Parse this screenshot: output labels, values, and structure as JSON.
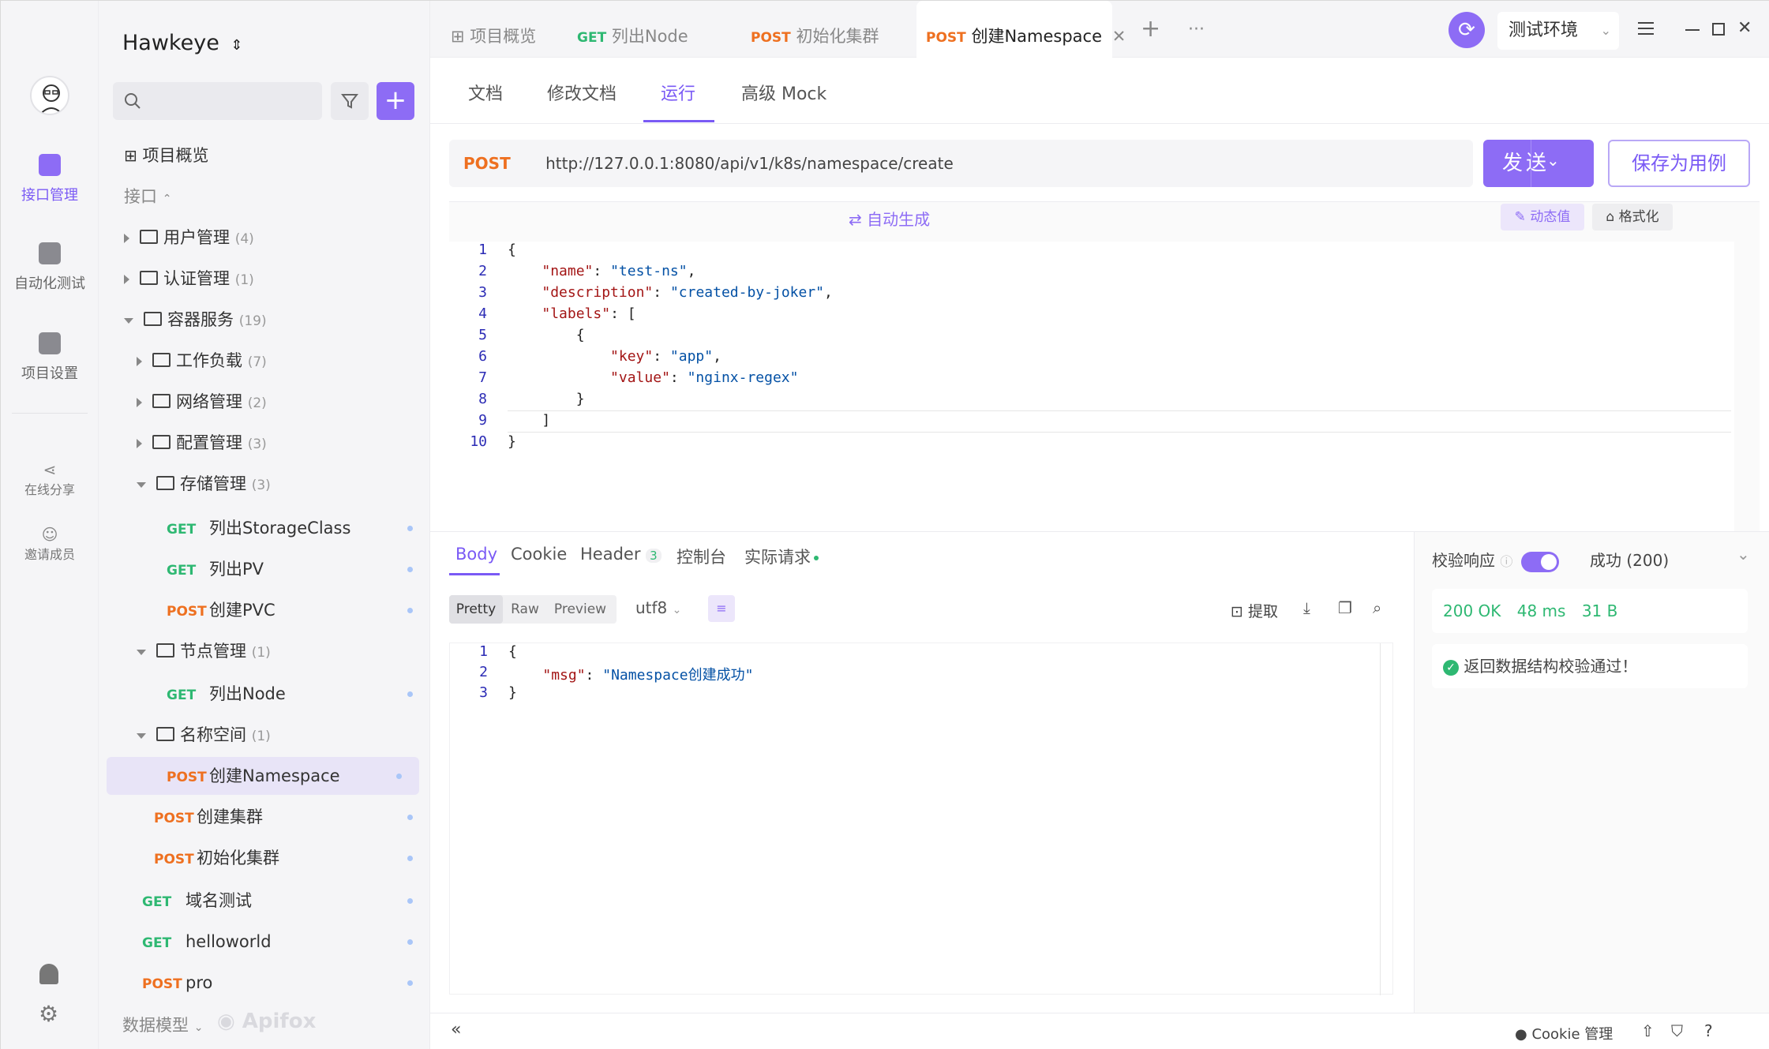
{
  "rail": {
    "items": [
      {
        "label": "接口管理"
      },
      {
        "label": "自动化测试"
      },
      {
        "label": "项目设置"
      }
    ],
    "share": "在线分享",
    "invite": "邀请成员"
  },
  "project": {
    "name": "Hawkeye",
    "switch_glyph": "⌃⌄"
  },
  "tree": {
    "overview": "项目概览",
    "api_label": "接口",
    "nodes": [
      {
        "name": "用户管理",
        "count": "(4)"
      },
      {
        "name": "认证管理",
        "count": "(1)"
      },
      {
        "name": "容器服务",
        "count": "(19)"
      },
      {
        "name": "工作负载",
        "count": "(7)"
      },
      {
        "name": "网络管理",
        "count": "(2)"
      },
      {
        "name": "配置管理",
        "count": "(3)"
      },
      {
        "name": "存储管理",
        "count": "(3)"
      },
      {
        "method": "GET",
        "name": "列出StorageClass"
      },
      {
        "method": "GET",
        "name": "列出PV"
      },
      {
        "method": "POST",
        "name": "创建PVC"
      },
      {
        "name": "节点管理",
        "count": "(1)"
      },
      {
        "method": "GET",
        "name": "列出Node"
      },
      {
        "name": "名称空间",
        "count": "(1)"
      },
      {
        "method": "POST",
        "name": "创建Namespace"
      },
      {
        "method": "POST",
        "name": "创建集群"
      },
      {
        "method": "POST",
        "name": "初始化集群"
      },
      {
        "method": "GET",
        "name": "域名测试"
      },
      {
        "method": "GET",
        "name": "helloworld"
      },
      {
        "method": "POST",
        "name": "pro"
      }
    ],
    "data_model": "数据模型",
    "brand": "Apifox"
  },
  "tabs": [
    {
      "method": "",
      "label": "项目概览"
    },
    {
      "method": "GET",
      "label": "列出Node"
    },
    {
      "method": "POST",
      "label": "初始化集群"
    },
    {
      "method": "POST",
      "label": "创建Namespace"
    }
  ],
  "tab_add": "+",
  "tab_more": "···",
  "env": {
    "label": "测试环境"
  },
  "subnav": [
    "文档",
    "修改文档",
    "运行",
    "高级 Mock"
  ],
  "request": {
    "method": "POST",
    "url": "http://127.0.0.1:8080/api/v1/k8s/namespace/create",
    "send_label": "发送",
    "save_label": "保存为用例",
    "auto_gen": "⇄ 自动生成",
    "dynamic": "动态值",
    "format": "格式化",
    "lines": [
      "1",
      "2",
      "3",
      "4",
      "5",
      "6",
      "7",
      "8",
      "9",
      "10"
    ]
  },
  "response": {
    "tabs": [
      "Body",
      "Cookie",
      "Header",
      "控制台",
      "实际请求"
    ],
    "header_count": "3",
    "views": [
      "Pretty",
      "Raw",
      "Preview"
    ],
    "encoding": "utf8",
    "extract": "提取",
    "lines": [
      "1",
      "2",
      "3"
    ],
    "validate_label": "校验响应",
    "validate_result": "成功 (200)",
    "status": "200 OK",
    "time": "48 ms",
    "size": "31 B",
    "schema_ok": "返回数据结构校验通过！"
  },
  "footer": {
    "cookie": "Cookie 管理"
  },
  "colors": {
    "accent": "#8d6cf5",
    "get": "#2eb872",
    "post": "#ee7020"
  }
}
